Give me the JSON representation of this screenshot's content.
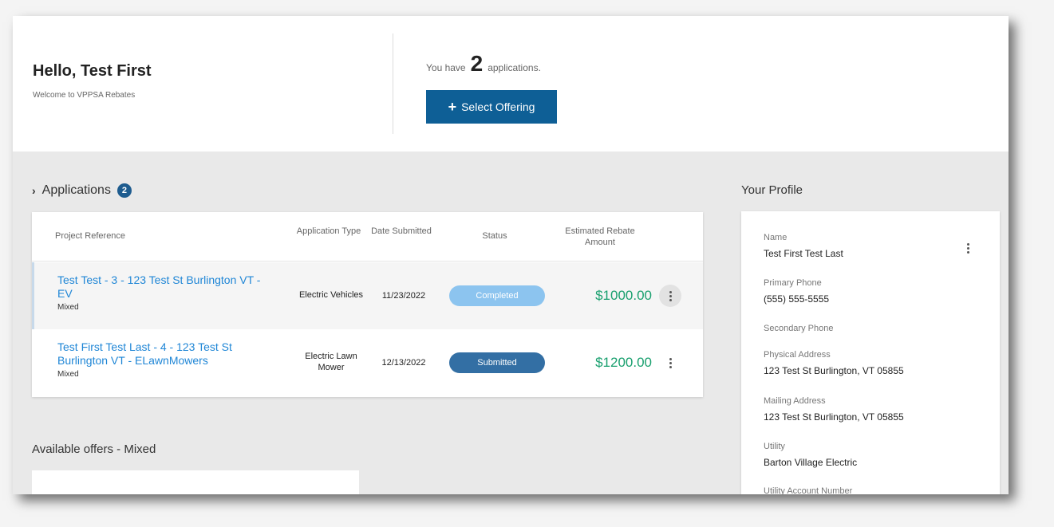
{
  "hero": {
    "greeting": "Hello, Test First",
    "welcome": "Welcome to VPPSA Rebates",
    "count_prefix": "You have",
    "count_value": "2",
    "count_suffix": "applications.",
    "select_button": "Select Offering",
    "select_icon": "plus-icon"
  },
  "applications": {
    "title": "Applications",
    "badge": "2",
    "chevron_icon": "chevron-right-icon",
    "columns": {
      "reference": "Project Reference",
      "type": "Application Type",
      "date": "Date Submitted",
      "status": "Status",
      "amount": "Estimated Rebate Amount"
    },
    "rows": [
      {
        "reference": "Test Test - 3 - 123 Test St Burlington VT - EV",
        "subtype": "Mixed",
        "type": "Electric Vehicles",
        "date": "11/23/2022",
        "status": "Completed",
        "amount": "$1000.00"
      },
      {
        "reference": "Test First Test Last - 4 - 123 Test St Burlington VT - ELawnMowers",
        "subtype": "Mixed",
        "type": "Electric Lawn Mower",
        "date": "12/13/2022",
        "status": "Submitted",
        "amount": "$1200.00"
      }
    ]
  },
  "offers": {
    "title": "Available offers - Mixed"
  },
  "profile": {
    "title": "Your Profile",
    "fields": [
      {
        "label": "Name",
        "value": "Test First Test Last"
      },
      {
        "label": "Primary Phone",
        "value": "(555) 555-5555"
      },
      {
        "label": "Secondary Phone",
        "value": ""
      },
      {
        "label": "Physical Address",
        "value": "123 Test St Burlington, VT 05855"
      },
      {
        "label": "Mailing Address",
        "value": "123 Test St Burlington, VT 05855"
      },
      {
        "label": "Utility",
        "value": "Barton Village Electric"
      },
      {
        "label": "Utility Account Number",
        "value": ""
      }
    ]
  },
  "colors": {
    "primary": "#0e5f96",
    "link": "#1f86d6",
    "amount": "#1aa06f",
    "completed": "#8cc4ef",
    "submitted": "#336fa4"
  }
}
